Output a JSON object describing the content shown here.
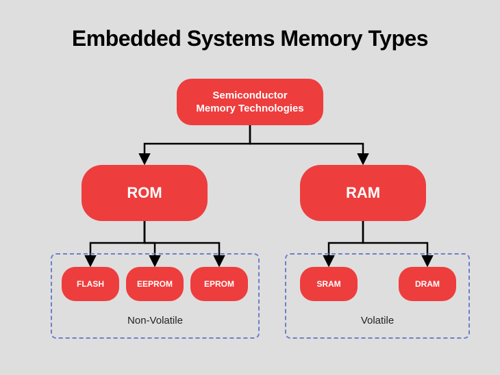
{
  "title": "Embedded Systems Memory Types",
  "root": "Semiconductor\nMemory Technologies",
  "level2": {
    "rom": "ROM",
    "ram": "RAM"
  },
  "rom_children": {
    "flash": "FLASH",
    "eeprom": "EEPROM",
    "eprom": "EPROM"
  },
  "ram_children": {
    "sram": "SRAM",
    "dram": "DRAM"
  },
  "groups": {
    "nonvolatile": "Non-Volatile",
    "volatile": "Volatile"
  },
  "colors": {
    "node": "#EE3D3D",
    "bg": "#DEDEDE",
    "dash": "#6B7FC7"
  }
}
